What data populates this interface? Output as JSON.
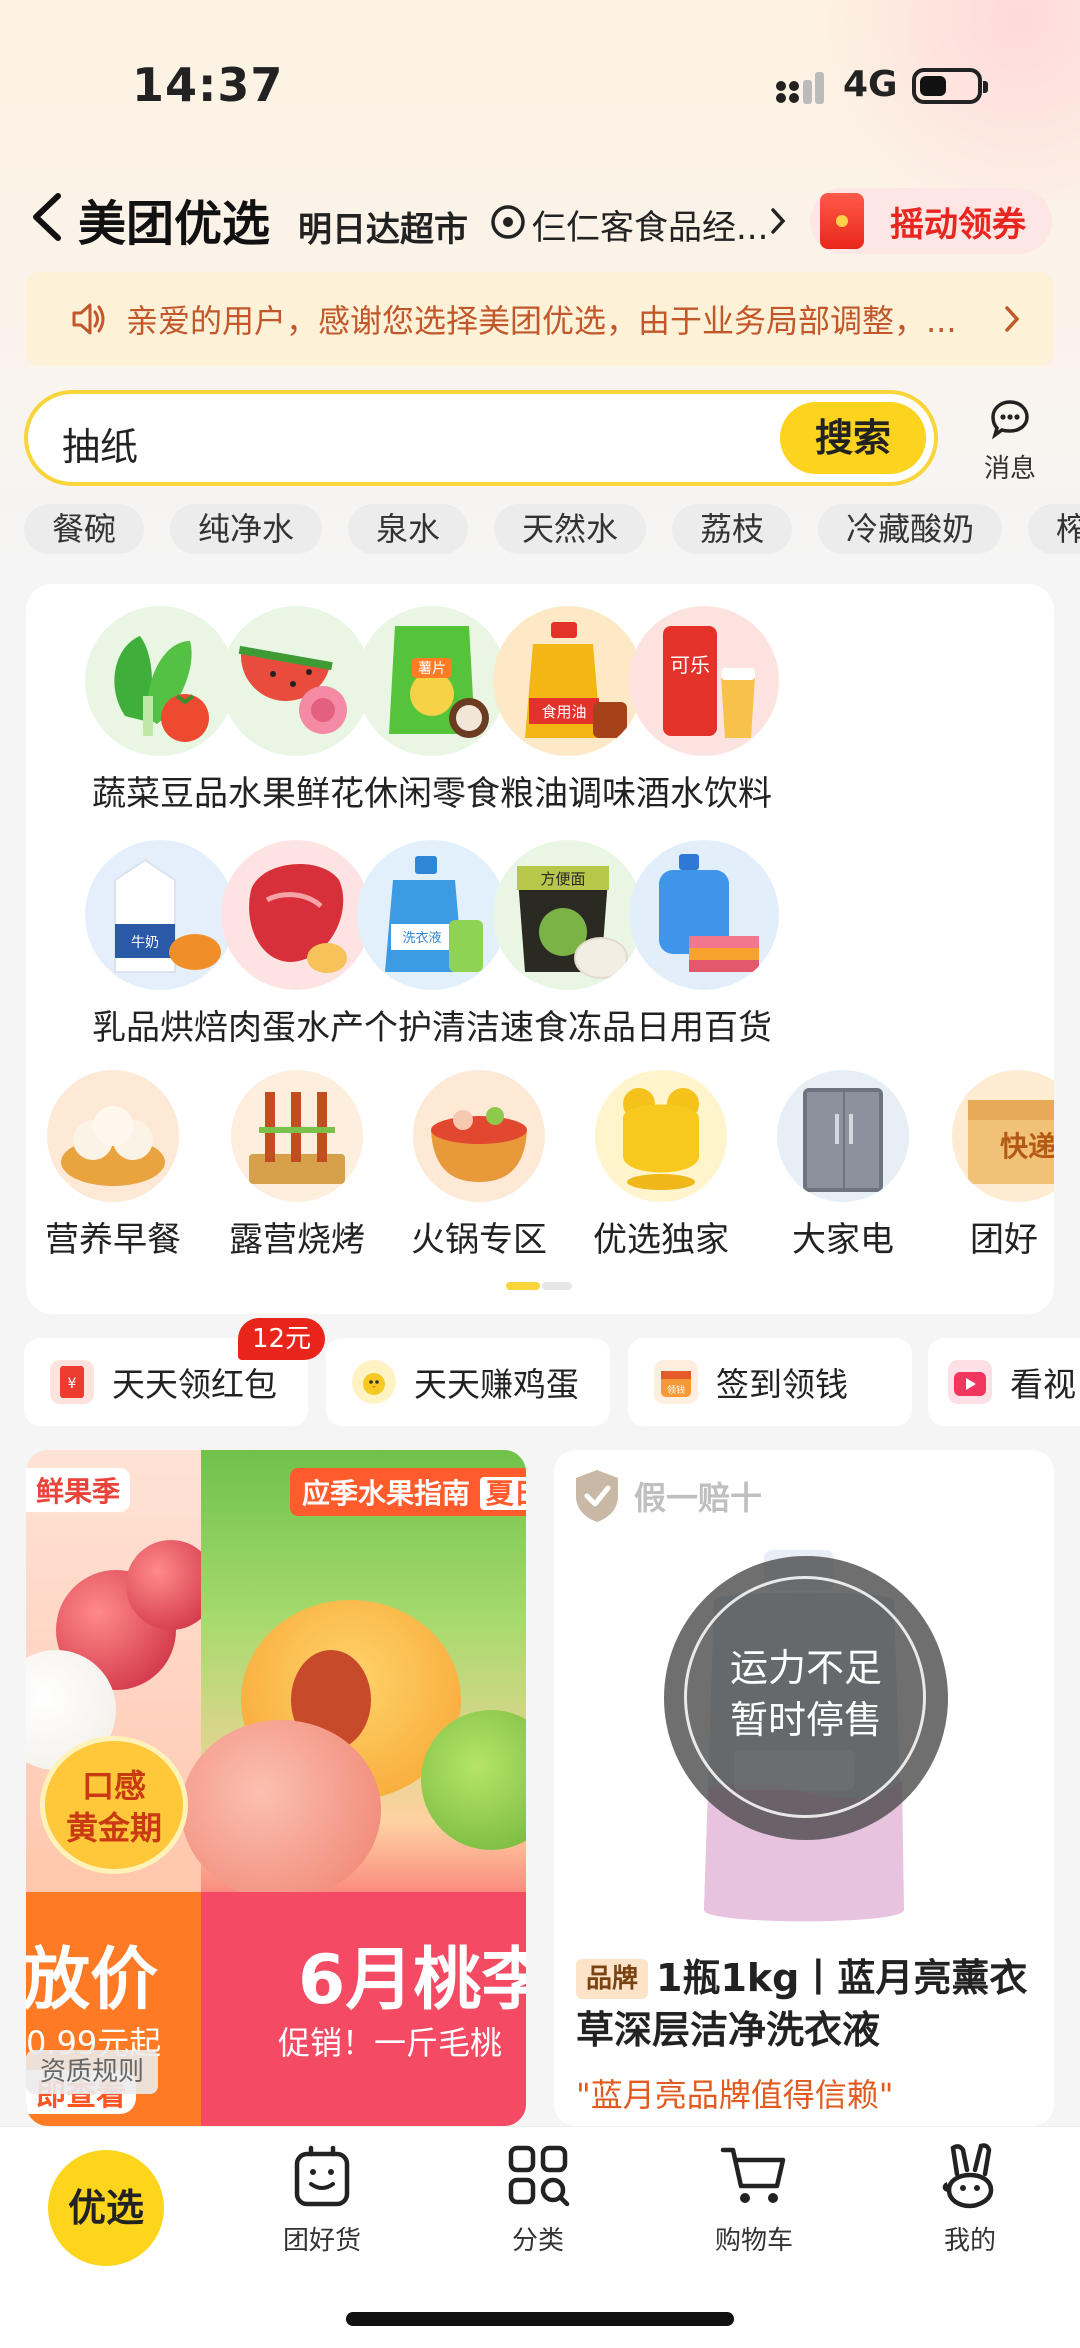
{
  "status_bar": {
    "time": "14:37",
    "network": "4G"
  },
  "header": {
    "title": "美团优选",
    "subtitle": "明日达超市",
    "store": "仨仁客食品经...",
    "shake_button": "摇动领券"
  },
  "notice": {
    "text": "亲爱的用户，感谢您选择美团优选，由于业务局部调整，..."
  },
  "search": {
    "placeholder": "抽纸",
    "button": "搜索"
  },
  "message": {
    "label": "消息"
  },
  "hot_chips": [
    "餐碗",
    "纯净水",
    "泉水",
    "天然水",
    "荔枝",
    "冷藏酸奶",
    "榨菜"
  ],
  "categories": [
    {
      "label": "蔬菜豆品",
      "icon": "vegetable-icon"
    },
    {
      "label": "水果鲜花",
      "icon": "watermelon-icon"
    },
    {
      "label": "休闲零食",
      "icon": "snack-icon",
      "icon_text": "薯片"
    },
    {
      "label": "粮油调味",
      "icon": "cooking-oil-icon",
      "icon_text": "食用油"
    },
    {
      "label": "酒水饮料",
      "icon": "cola-can-icon",
      "icon_text": "可乐"
    },
    {
      "label": "乳品烘焙",
      "icon": "milk-carton-icon",
      "icon_text": "牛奶"
    },
    {
      "label": "肉蛋水产",
      "icon": "meat-icon"
    },
    {
      "label": "个护清洁",
      "icon": "detergent-icon",
      "icon_text": "洗衣液"
    },
    {
      "label": "速食冻品",
      "icon": "instant-noodle-icon",
      "icon_text": "方便面"
    },
    {
      "label": "日用百货",
      "icon": "daily-goods-icon"
    },
    {
      "label": "营养早餐",
      "icon": "steamed-bun-icon"
    },
    {
      "label": "露营烧烤",
      "icon": "bbq-icon"
    },
    {
      "label": "火锅专区",
      "icon": "hotpot-icon"
    },
    {
      "label": "优选独家",
      "icon": "exclusive-icon"
    },
    {
      "label": "大家电",
      "icon": "fridge-icon"
    },
    {
      "label": "团好",
      "icon": "group-box-icon",
      "icon_text": "快递"
    }
  ],
  "quick_tasks": [
    {
      "label": "天天领红包",
      "badge": "12元"
    },
    {
      "label": "天天赚鸡蛋"
    },
    {
      "label": "签到领钱",
      "icon_text": "领钱"
    },
    {
      "label": "看视"
    }
  ],
  "promo": {
    "tag_left": "鲜果季",
    "tag_right": "应季水果指南",
    "tag_right_extra": "夏日",
    "badge_line1": "口感",
    "badge_line2": "黄金期",
    "left_big": "放价",
    "left_sub": "0.99元起",
    "left_cta": "即查看",
    "right_big": "6月桃李",
    "right_sub": "促销！一斤毛桃",
    "rules": "资质规则"
  },
  "product": {
    "guarantee": "假一赔十",
    "status_line1": "运力不足",
    "status_line2": "暂时停售",
    "brand_tag": "品牌",
    "title": "1瓶1kg丨蓝月亮薰衣草深层洁净洗衣液",
    "slogan": "\"蓝月亮品牌值得信赖\""
  },
  "tabbar": {
    "home": "优选",
    "items": [
      {
        "label": "团好货",
        "icon": "bag-icon"
      },
      {
        "label": "分类",
        "icon": "grid-icon"
      },
      {
        "label": "购物车",
        "icon": "cart-icon"
      },
      {
        "label": "我的",
        "icon": "rabbit-icon"
      }
    ]
  },
  "colors": {
    "accent": "#fcd31f",
    "brand_red": "#e8251f",
    "notice_text": "#c1572a"
  }
}
